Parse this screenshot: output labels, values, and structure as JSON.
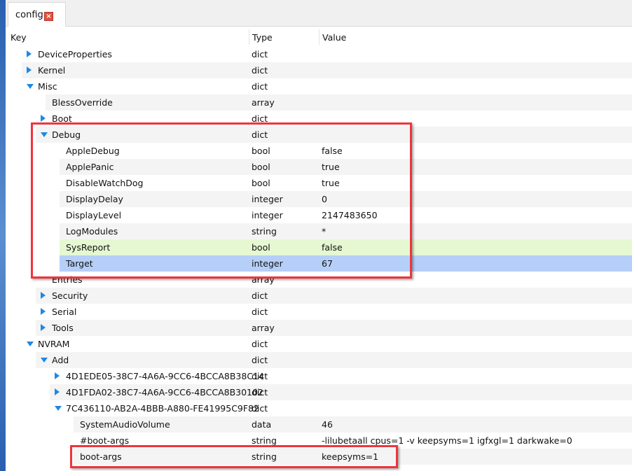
{
  "tab": {
    "label": "config",
    "close_icon": "close-icon"
  },
  "columns": {
    "key": "Key",
    "type": "Type",
    "value": "Value"
  },
  "rows": [
    {
      "key": "DeviceProperties",
      "type": "dict",
      "value": "",
      "level": 1,
      "node": "collapsed"
    },
    {
      "key": "Kernel",
      "type": "dict",
      "value": "",
      "level": 1,
      "node": "collapsed"
    },
    {
      "key": "Misc",
      "type": "dict",
      "value": "",
      "level": 1,
      "node": "expanded"
    },
    {
      "key": "BlessOverride",
      "type": "array",
      "value": "",
      "level": 2,
      "node": "leaf"
    },
    {
      "key": "Boot",
      "type": "dict",
      "value": "",
      "level": 2,
      "node": "collapsed"
    },
    {
      "key": "Debug",
      "type": "dict",
      "value": "",
      "level": 2,
      "node": "expanded"
    },
    {
      "key": "AppleDebug",
      "type": "bool",
      "value": "false",
      "level": 3,
      "node": "leaf"
    },
    {
      "key": "ApplePanic",
      "type": "bool",
      "value": "true",
      "level": 3,
      "node": "leaf"
    },
    {
      "key": "DisableWatchDog",
      "type": "bool",
      "value": "true",
      "level": 3,
      "node": "leaf"
    },
    {
      "key": "DisplayDelay",
      "type": "integer",
      "value": "0",
      "level": 3,
      "node": "leaf"
    },
    {
      "key": "DisplayLevel",
      "type": "integer",
      "value": "2147483650",
      "level": 3,
      "node": "leaf"
    },
    {
      "key": "LogModules",
      "type": "string",
      "value": "*",
      "level": 3,
      "node": "leaf"
    },
    {
      "key": "SysReport",
      "type": "bool",
      "value": "false",
      "level": 3,
      "node": "leaf",
      "state": "green"
    },
    {
      "key": "Target",
      "type": "integer",
      "value": "67",
      "level": 3,
      "node": "leaf",
      "state": "sel"
    },
    {
      "key": "Entries",
      "type": "array",
      "value": "",
      "level": 2,
      "node": "leaf"
    },
    {
      "key": "Security",
      "type": "dict",
      "value": "",
      "level": 2,
      "node": "collapsed"
    },
    {
      "key": "Serial",
      "type": "dict",
      "value": "",
      "level": 2,
      "node": "collapsed"
    },
    {
      "key": "Tools",
      "type": "array",
      "value": "",
      "level": 2,
      "node": "collapsed"
    },
    {
      "key": "NVRAM",
      "type": "dict",
      "value": "",
      "level": 1,
      "node": "expanded"
    },
    {
      "key": "Add",
      "type": "dict",
      "value": "",
      "level": 2,
      "node": "expanded"
    },
    {
      "key": "4D1EDE05-38C7-4A6A-9CC6-4BCCA8B38C14",
      "type": "dict",
      "value": "",
      "level": 3,
      "node": "collapsed"
    },
    {
      "key": "4D1FDA02-38C7-4A6A-9CC6-4BCCA8B30102",
      "type": "dict",
      "value": "",
      "level": 3,
      "node": "collapsed"
    },
    {
      "key": "7C436110-AB2A-4BBB-A880-FE41995C9F82",
      "type": "dict",
      "value": "",
      "level": 3,
      "node": "expanded"
    },
    {
      "key": "SystemAudioVolume",
      "type": "data",
      "value": "46",
      "level": 4,
      "node": "leaf"
    },
    {
      "key": "#boot-args",
      "type": "string",
      "value": "-lilubetaall cpus=1 -v  keepsyms=1 igfxgl=1 darkwake=0",
      "level": 4,
      "node": "leaf"
    },
    {
      "key": "boot-args",
      "type": "string",
      "value": "keepsyms=1",
      "level": 4,
      "node": "leaf"
    }
  ]
}
